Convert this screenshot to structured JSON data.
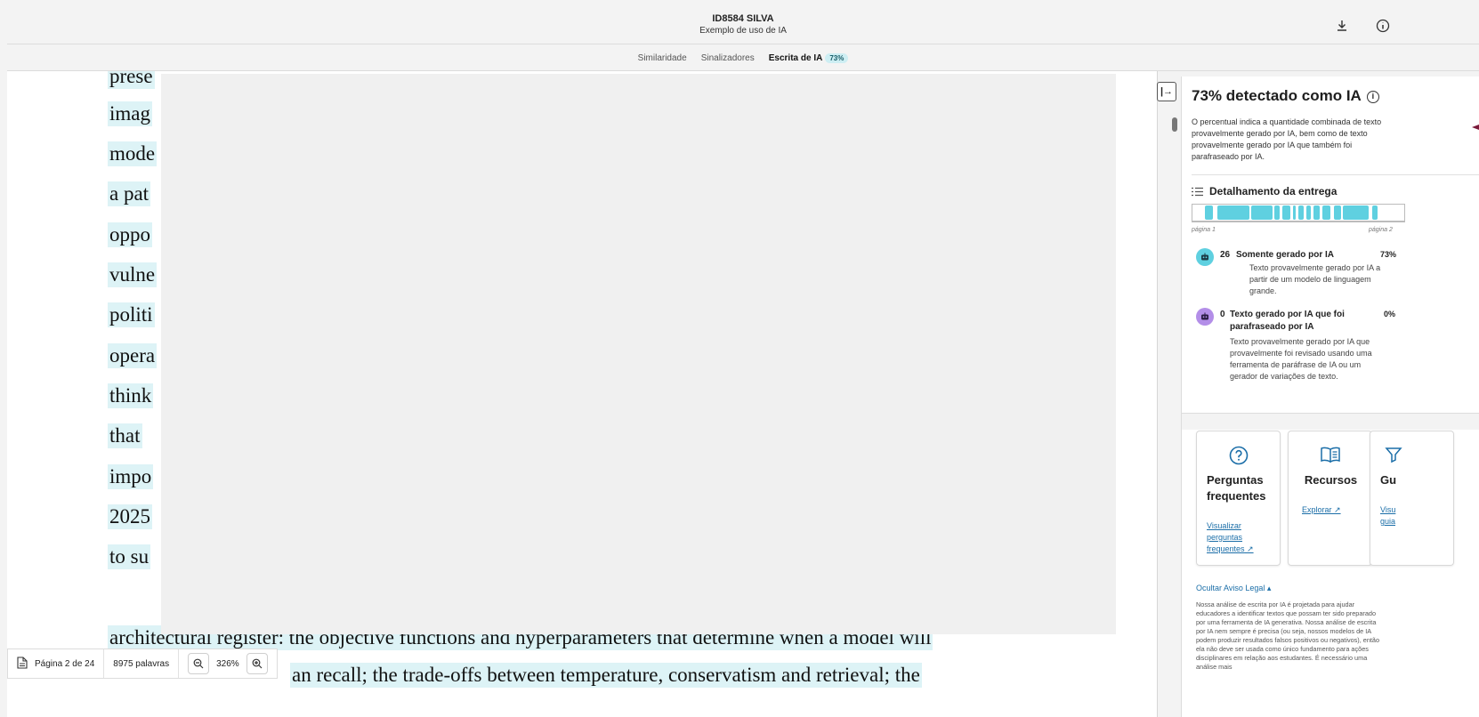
{
  "header": {
    "title": "ID8584 SILVA",
    "subtitle": "Exemplo de uso de IA",
    "download_icon": "download-icon",
    "info_icon": "info-icon"
  },
  "tabs": [
    {
      "label": "Similaridade"
    },
    {
      "label": "Sinalizadores"
    },
    {
      "label": "Escrita de IA",
      "badge": "73%"
    }
  ],
  "document": {
    "lines": [
      "prese",
      "imag",
      "mode",
      "a pat",
      "oppo",
      "vulne",
      "politi",
      "opera",
      "think",
      "that",
      "impo",
      "2025",
      "to su",
      "architectural register: the objective functions and hyperparameters that determine when a model will",
      "an recall; the trade-offs between temperature, conservatism and retrieval; the"
    ]
  },
  "footer": {
    "page_label": "Página 2 de 24",
    "word_count": "8975 palavras",
    "zoom": "326%"
  },
  "panel": {
    "title": "73% detectado como IA",
    "description": "O percentual indica a quantidade combinada de texto provavelmente gerado por IA, bem como de texto provavelmente gerado por IA que também foi parafraseado por IA.",
    "breakdown_title": "Detalhamento da entrega",
    "page_start": "página 1",
    "page_end": "página 2",
    "categories": [
      {
        "count": "26",
        "name": "Somente gerado por IA",
        "percent": "73%",
        "description": "Texto provavelmente gerado por IA a partir de um modelo de linguagem grande.",
        "color": "#5fd0e0"
      },
      {
        "count": "0",
        "name": "Texto gerado por IA que foi parafraseado por IA",
        "percent": "0%",
        "description": "Texto provavelmente gerado por IA que provavelmente foi revisado usando uma ferramenta de paráfrase de IA ou um gerador de variações de texto.",
        "color": "#b38ee8"
      }
    ],
    "cards": [
      {
        "title": "Perguntas frequentes",
        "link": "Visualizar perguntas frequentes",
        "icon": "question-circle-icon"
      },
      {
        "title": "Recursos",
        "link": "Explorar",
        "icon": "book-icon"
      },
      {
        "title": "Gu",
        "link": "Visu guia",
        "icon": "filter-icon"
      }
    ],
    "legal_toggle": "Ocultar Aviso Legal",
    "legal_text": "Nossa análise de escrita por IA é projetada para ajudar educadores a identificar textos que possam ter sido preparado por uma ferramenta de IA generativa. Nossa análise de escrita por IA nem sempre é precisa (ou seja, nossos modelos de IA podem produzir resultados falsos positivos ou negativos), então ela não deve ser usada como único fundamento para ações disciplinares em relação aos estudantes. É necessário uma análise mais"
  },
  "colors": {
    "highlight": "#ddf3f6",
    "accent": "#5fd0e0",
    "link": "#1b6ea8",
    "paraphrase": "#b38ee8"
  }
}
